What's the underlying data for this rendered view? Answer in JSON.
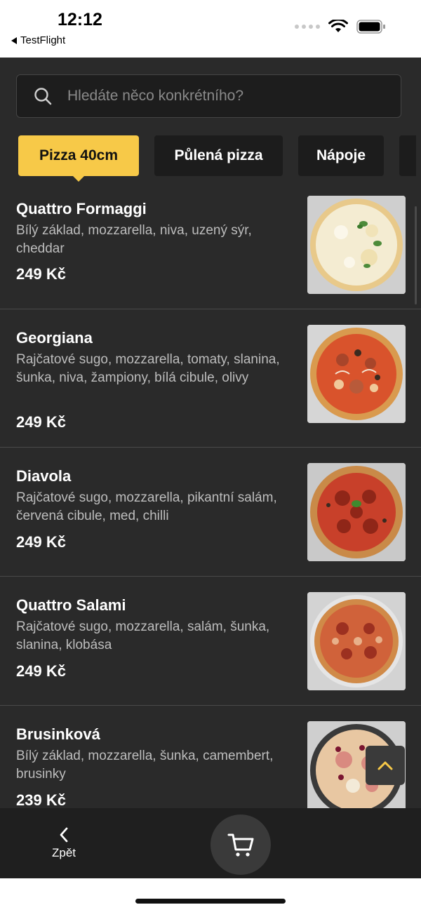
{
  "status_bar": {
    "time": "12:12",
    "back_app": "TestFlight"
  },
  "search": {
    "placeholder": "Hledáte něco konkrétního?"
  },
  "categories": [
    {
      "label": "Pizza 40cm",
      "active": true
    },
    {
      "label": "Půlená pizza",
      "active": false
    },
    {
      "label": "Nápoje",
      "active": false
    }
  ],
  "menu_items": [
    {
      "name": "Quattro Formaggi",
      "description": "Bílý základ, mozzarella, niva, uzený sýr, cheddar",
      "price": "249 Kč",
      "image": "pizza-white-cheese"
    },
    {
      "name": "Georgiana",
      "description": "Rajčatové sugo, mozzarella, tomaty, slanina, šunka, niva, žampiony, bílá cibule, olivy",
      "price": "249 Kč",
      "image": "pizza-red-mixed"
    },
    {
      "name": "Diavola",
      "description": "Rajčatové sugo, mozzarella, pikantní salám, červená cibule, med, chilli",
      "price": "249 Kč",
      "image": "pizza-salami"
    },
    {
      "name": "Quattro Salami",
      "description": "Rajčatové sugo, mozzarella, salám, šunka, slanina, klobása",
      "price": "249 Kč",
      "image": "pizza-quattro-salami"
    },
    {
      "name": "Brusinková",
      "description": "Bílý základ, mozzarella, šunka, camembert, brusinky",
      "price": "239 Kč",
      "image": "pizza-cranberry"
    }
  ],
  "bottom_nav": {
    "back_label": "Zpět",
    "cart_icon": "cart-icon",
    "back_icon": "chevron-left-icon"
  },
  "colors": {
    "accent": "#f7c948",
    "background": "#2a2a2a",
    "bottom_bar": "#1f1f1f"
  }
}
